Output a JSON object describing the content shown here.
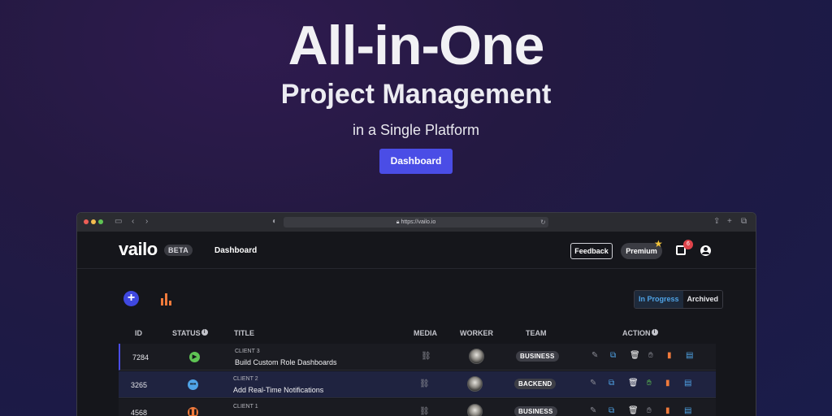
{
  "hero": {
    "title": "All-in-One",
    "subtitle": "Project Management",
    "tagline": "in a Single Platform",
    "cta": "Dashboard"
  },
  "browser": {
    "url": "https://vailo.io"
  },
  "app": {
    "logo": "vailo",
    "beta": "BETA",
    "nav_dashboard": "Dashboard",
    "feedback": "Feedback",
    "premium": "Premium",
    "notifications": "6",
    "filters": [
      "In Progress",
      "Archived"
    ],
    "accent": "#4a4de6"
  },
  "table": {
    "headers": [
      "ID",
      "STATUS",
      "TITLE",
      "MEDIA",
      "WORKER",
      "TEAM",
      "ACTION"
    ],
    "rows": [
      {
        "id": "7284",
        "status": "play",
        "status_color": "#5fc454",
        "client": "CLIENT 3",
        "title": "Build Custom Role Dashboards",
        "team": "BUSINESS",
        "approve_color": "#8c8d96"
      },
      {
        "id": "3265",
        "status": "more",
        "status_color": "#4fa3e6",
        "client": "CLIENT 2",
        "title": "Add Real-Time Notifications",
        "team": "BACKEND",
        "approve_color": "#5fc454"
      },
      {
        "id": "4568",
        "status": "pause",
        "status_color": "#f07a3b",
        "client": "CLIENT 1",
        "title": "",
        "team": "BUSINESS",
        "approve_color": "#8c8d96"
      }
    ]
  }
}
